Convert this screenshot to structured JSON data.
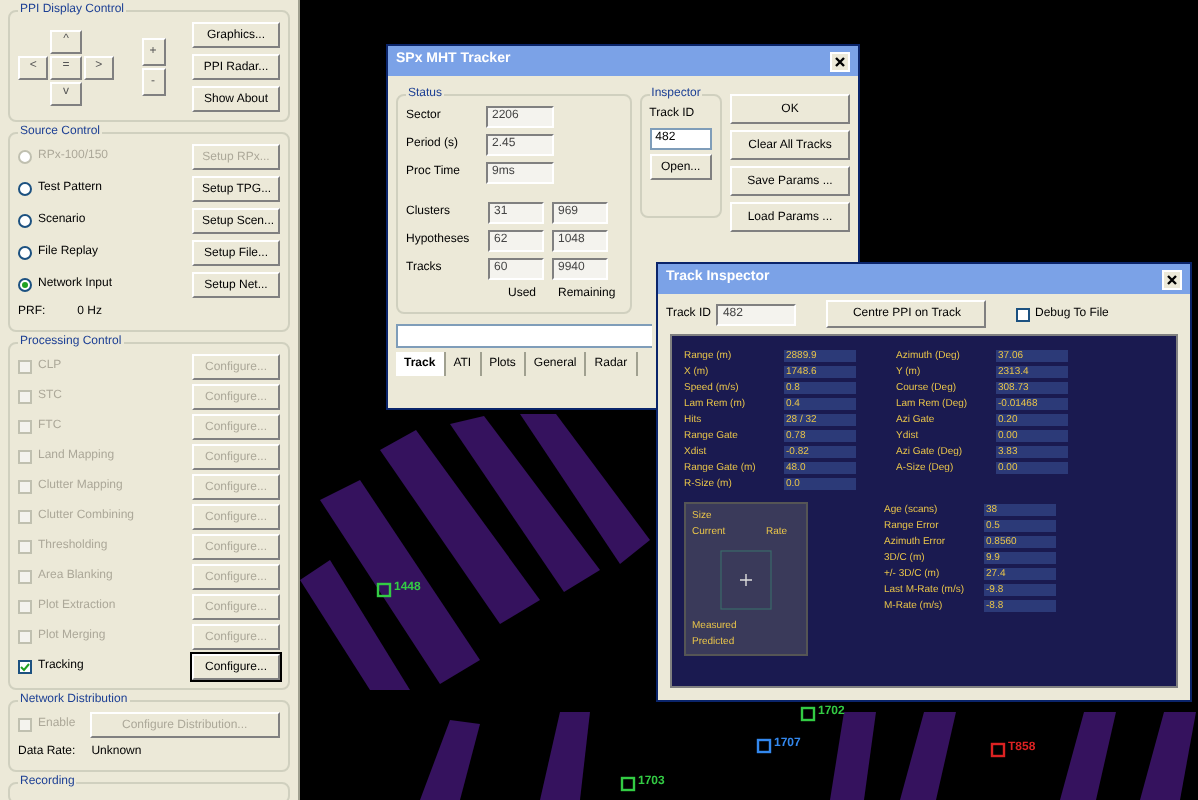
{
  "ppi_display_control": {
    "title": "PPI Display Control",
    "pad_keys": [
      "^",
      "<",
      "=",
      ">",
      "v"
    ],
    "zoom_keys": [
      "+",
      "-"
    ],
    "buttons": [
      "Graphics...",
      "PPI Radar...",
      "Show About"
    ]
  },
  "source_control": {
    "title": "Source Control",
    "options": [
      {
        "label": "RPx-100/150",
        "button": "Setup RPx...",
        "selected": false,
        "disabled": true
      },
      {
        "label": "Test Pattern",
        "button": "Setup TPG...",
        "selected": false,
        "disabled": false
      },
      {
        "label": "Scenario",
        "button": "Setup Scen...",
        "selected": false,
        "disabled": false
      },
      {
        "label": "File Replay",
        "button": "Setup File...",
        "selected": false,
        "disabled": false
      },
      {
        "label": "Network Input",
        "button": "Setup Net...",
        "selected": true,
        "disabled": false
      }
    ],
    "prf_label": "PRF:",
    "prf_value": "0 Hz"
  },
  "processing_control": {
    "title": "Processing Control",
    "items": [
      {
        "label": "CLP",
        "button": "Configure...",
        "checked": false,
        "disabled": true
      },
      {
        "label": "STC",
        "button": "Configure...",
        "checked": false,
        "disabled": true
      },
      {
        "label": "FTC",
        "button": "Configure...",
        "checked": false,
        "disabled": true
      },
      {
        "label": "Land Mapping",
        "button": "Configure...",
        "checked": false,
        "disabled": true
      },
      {
        "label": "Clutter Mapping",
        "button": "Configure...",
        "checked": false,
        "disabled": true
      },
      {
        "label": "Clutter Combining",
        "button": "Configure...",
        "checked": false,
        "disabled": true
      },
      {
        "label": "Thresholding",
        "button": "Configure...",
        "checked": false,
        "disabled": true
      },
      {
        "label": "Area Blanking",
        "button": "Configure...",
        "checked": false,
        "disabled": true
      },
      {
        "label": "Plot Extraction",
        "button": "Configure...",
        "checked": false,
        "disabled": true
      },
      {
        "label": "Plot Merging",
        "button": "Configure...",
        "checked": false,
        "disabled": true
      },
      {
        "label": "Tracking",
        "button": "Configure...",
        "checked": true,
        "disabled": false
      }
    ]
  },
  "network_distribution": {
    "title": "Network Distribution",
    "enable": {
      "label": "Enable",
      "checked": false,
      "disabled": true
    },
    "button": {
      "label": "Configure Distribution...",
      "disabled": true
    },
    "data_rate_label": "Data Rate:",
    "data_rate_value": "Unknown"
  },
  "recording": {
    "title": "Recording"
  },
  "radar": {
    "tracks": [
      {
        "label": "1448",
        "color": "#33cc44"
      },
      {
        "label": "1702",
        "color": "#33cc44"
      },
      {
        "label": "1707",
        "color": "#3388ee"
      },
      {
        "label": "T858",
        "color": "#dd2222"
      },
      {
        "label": "1703",
        "color": "#33cc44"
      }
    ]
  },
  "mht_tracker": {
    "title": "SPx MHT Tracker",
    "status": {
      "title": "Status",
      "fields": [
        {
          "label": "Sector",
          "value": "2206"
        },
        {
          "label": "Period (s)",
          "value": "2.45"
        },
        {
          "label": "Proc Time",
          "value": "9ms"
        }
      ],
      "counts": [
        {
          "label": "Clusters",
          "used": "31",
          "remaining": "969"
        },
        {
          "label": "Hypotheses",
          "used": "62",
          "remaining": "1048"
        },
        {
          "label": "Tracks",
          "used": "60",
          "remaining": "9940"
        }
      ],
      "used_label": "Used",
      "remaining_label": "Remaining"
    },
    "inspector": {
      "title": "Inspector",
      "track_id_label": "Track ID",
      "track_id": "482",
      "open_button": "Open..."
    },
    "buttons": [
      "OK",
      "Clear All Tracks",
      "Save Params ...",
      "Load Params ..."
    ],
    "tabs": [
      {
        "label": "Track",
        "selected": true
      },
      {
        "label": "ATI",
        "selected": false
      },
      {
        "label": "Plots",
        "selected": false
      },
      {
        "label": "General",
        "selected": false
      },
      {
        "label": "Radar",
        "selected": false
      }
    ]
  },
  "track_inspector": {
    "title": "Track Inspector",
    "track_id_label": "Track ID",
    "track_id": "482",
    "centre_button": "Centre PPI on Track",
    "debug": {
      "label": "Debug To File",
      "checked": false
    },
    "left_fields": [
      {
        "label": "Range (m)",
        "value": "2889.9"
      },
      {
        "label": "X (m)",
        "value": "1748.6"
      },
      {
        "label": "Speed (m/s)",
        "value": "0.8"
      },
      {
        "label": "Lam Rem (m)",
        "value": "0.4"
      },
      {
        "label": "Hits",
        "value": "28 / 32"
      },
      {
        "label": "Range Gate",
        "value": "0.78"
      },
      {
        "label": "Xdist",
        "value": "-0.82"
      },
      {
        "label": "Range Gate (m)",
        "value": "48.0"
      },
      {
        "label": "R-Size (m)",
        "value": "0.0"
      }
    ],
    "right_fields": [
      {
        "label": "Azimuth (Deg)",
        "value": "37.06"
      },
      {
        "label": "Y (m)",
        "value": "2313.4"
      },
      {
        "label": "Course (Deg)",
        "value": "308.73"
      },
      {
        "label": "Lam Rem (Deg)",
        "value": "-0.01468"
      },
      {
        "label": "Azi Gate",
        "value": "0.20"
      },
      {
        "label": "Ydist",
        "value": "0.00"
      },
      {
        "label": "Azi Gate (Deg)",
        "value": "3.83"
      },
      {
        "label": "A-Size (Deg)",
        "value": "0.00"
      }
    ],
    "lower_fields": [
      {
        "label": "Age (scans)",
        "value": "38"
      },
      {
        "label": "Range Error",
        "value": "0.5"
      },
      {
        "label": "Azimuth Error",
        "value": "0.8560"
      },
      {
        "label": "3D/C (m)",
        "value": "9.9"
      },
      {
        "label": "+/- 3D/C (m)",
        "value": "27.4"
      },
      {
        "label": "Last M-Rate (m/s)",
        "value": "-9.8"
      },
      {
        "label": "M-Rate (m/s)",
        "value": "-8.8"
      }
    ],
    "legend": {
      "size": "Size",
      "current": "Current",
      "rate": "Rate",
      "measured": "Measured",
      "predicted": "Predicted"
    }
  }
}
